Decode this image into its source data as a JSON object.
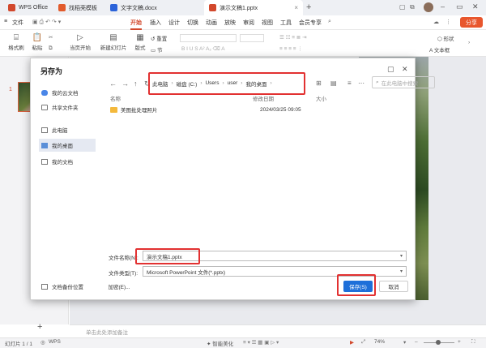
{
  "tabs": [
    {
      "label": "WPS Office",
      "icon": "wps-logo-icon",
      "color": "#d2482c"
    },
    {
      "label": "找稻壳模板",
      "icon": "docer-icon",
      "color": "#e25b2c"
    },
    {
      "label": "文字文稿.docx",
      "icon": "word-doc-icon",
      "color": "#2b63d9"
    },
    {
      "label": "演示文稿1.pptx",
      "icon": "ppt-icon",
      "color": "#d2482c"
    }
  ],
  "menu": {
    "file": "文件",
    "items": [
      "开始",
      "插入",
      "设计",
      "切换",
      "动画",
      "放映",
      "审阅",
      "视图",
      "工具",
      "会员专享"
    ],
    "share": "分享"
  },
  "ribbon": {
    "format_painter": "格式刷",
    "paste": "粘贴",
    "play_from_current": "当页开始",
    "new_slide": "新建幻灯片",
    "layout": "版式",
    "section": "节",
    "reset": "重置",
    "shape": "形状",
    "textbox": "文本框"
  },
  "dialog": {
    "title": "另存为",
    "sidebar": [
      {
        "label": "我的云文档",
        "icon": "cloud-icon"
      },
      {
        "label": "共享文件夹",
        "icon": "shared-folder-icon"
      },
      {
        "label": "此电脑",
        "icon": "computer-icon"
      },
      {
        "label": "我的桌面",
        "icon": "desktop-folder-icon"
      },
      {
        "label": "我的文档",
        "icon": "documents-icon"
      }
    ],
    "breadcrumb": [
      "此电脑",
      "磁盘 (C:)",
      "Users",
      "user",
      "我的桌面"
    ],
    "search_placeholder": "在此电脑中搜索",
    "columns": {
      "name": "名称",
      "modified": "修改日期",
      "size": "大小"
    },
    "files": [
      {
        "name": "美图批处理照片",
        "modified": "2024/03/25 09:05",
        "size": ""
      }
    ],
    "filename_label": "文件名称(N):",
    "filename_value": "演示文稿1.pptx",
    "filetype_label": "文件类型(T):",
    "filetype_value": "Microsoft PowerPoint 文件(*.pptx)",
    "encrypt_label": "加密(E)...",
    "backup_label": "文档备份位置",
    "save_label": "保存(S)",
    "cancel_label": "取消"
  },
  "notes_placeholder": "单击此处添加备注",
  "status": {
    "slide_counter": "幻灯片 1 / 1",
    "app": "WPS",
    "smart_beautify": "智能美化",
    "zoom": "74%"
  },
  "colors": {
    "accent": "#d2482c",
    "primary_button": "#1e6fd9",
    "highlight_box": "#e23131"
  }
}
